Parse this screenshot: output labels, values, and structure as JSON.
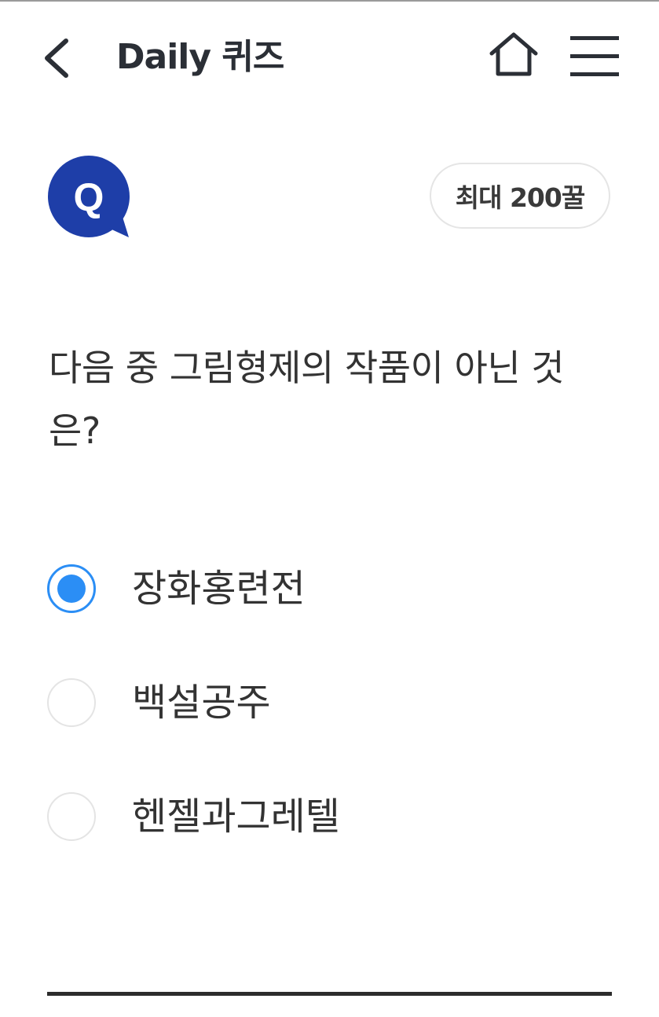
{
  "header": {
    "title": "Daily 퀴즈"
  },
  "badge": {
    "letter": "Q",
    "color": "#1e3ea8"
  },
  "points": {
    "label": "최대 200꿀"
  },
  "question": {
    "text": "다음 중 그림형제의 작품이 아닌 것은?"
  },
  "options": [
    {
      "label": "장화홍련전",
      "selected": true
    },
    {
      "label": "백설공주",
      "selected": false
    },
    {
      "label": "헨젤과그레텔",
      "selected": false
    }
  ],
  "colors": {
    "accent": "#2b8ef5",
    "badge": "#1e3ea8"
  }
}
